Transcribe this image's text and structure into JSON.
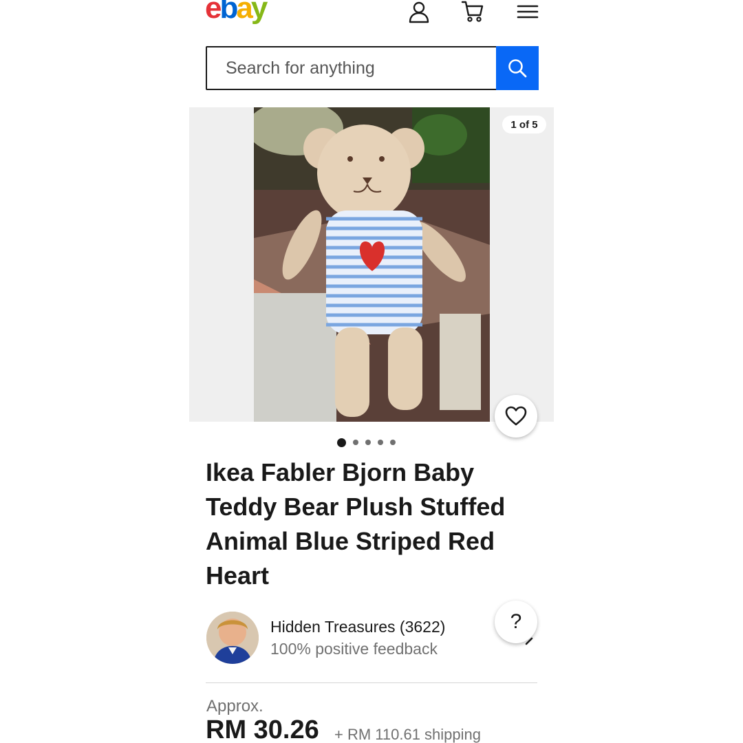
{
  "header": {
    "logo_letters": [
      "e",
      "b",
      "a",
      "y"
    ],
    "logo_colors": [
      "#e53238",
      "#0064d2",
      "#f5af02",
      "#86b817"
    ],
    "icons": [
      "account-icon",
      "cart-icon",
      "menu-icon"
    ]
  },
  "search": {
    "placeholder": "Search for anything",
    "button_icon": "search-icon",
    "button_color": "#0968f6"
  },
  "gallery": {
    "counter": "1 of 5",
    "image_count": 5,
    "active_index": 0
  },
  "listing": {
    "title": "Ikea Fabler Bjorn Baby Teddy Bear Plush Stuffed Animal Blue Striped Red Heart"
  },
  "seller": {
    "name": "Hidden Treasures (3622)",
    "feedback": "100% positive feedback"
  },
  "price": {
    "approx_label": "Approx.",
    "amount": "RM 30.26",
    "shipping": "+ RM 110.61 shipping"
  }
}
